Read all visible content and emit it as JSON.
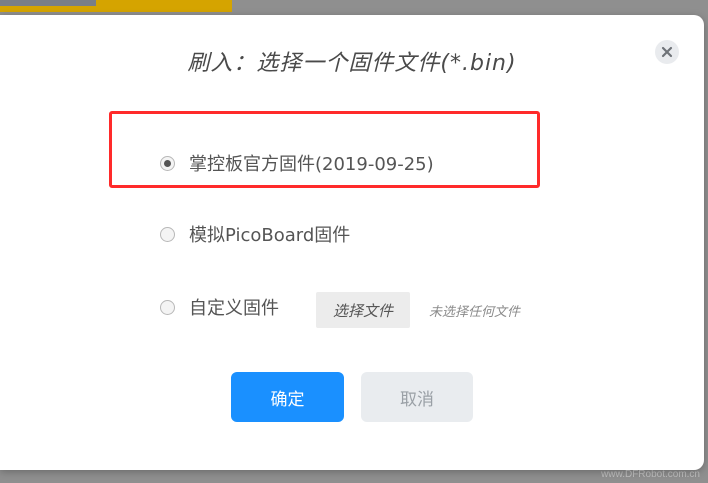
{
  "dialog": {
    "title": "刷入：选择一个固件文件(*.bin)",
    "options": [
      {
        "label": "掌控板官方固件(2019-09-25)",
        "checked": true
      },
      {
        "label": "模拟PicoBoard固件",
        "checked": false
      },
      {
        "label": "自定义固件",
        "checked": false
      }
    ],
    "choose_file_label": "选择文件",
    "file_status": "未选择任何文件",
    "ok_label": "确定",
    "cancel_label": "取消"
  },
  "watermark": "www.DFRobot.com.cn",
  "colors": {
    "primary": "#1a90ff",
    "highlight": "#ff2a2a",
    "backdrop": "#8f8f8f"
  },
  "icons": {
    "close": "close-icon"
  }
}
